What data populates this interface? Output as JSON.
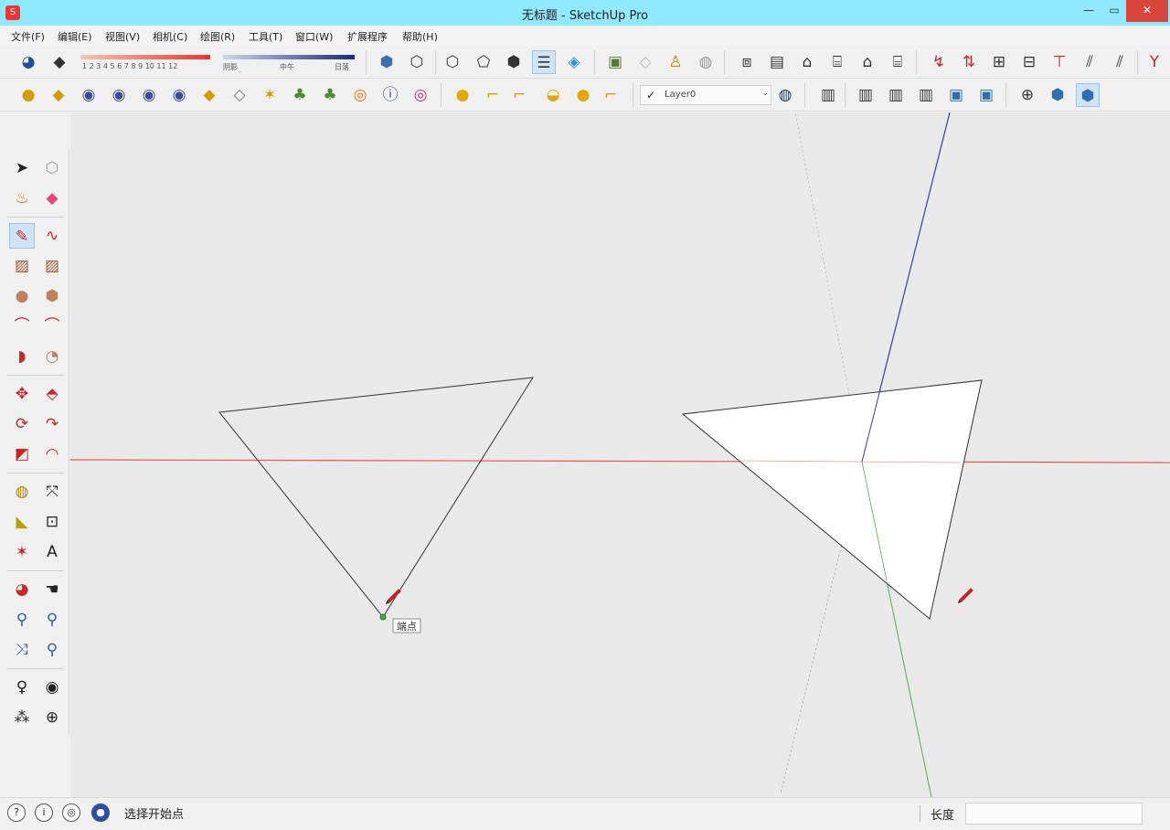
{
  "window": {
    "title": "无标题 - SketchUp Pro",
    "minimize": "—",
    "maximize": "▭",
    "close": "✕"
  },
  "menu": [
    {
      "label": "文件(F)"
    },
    {
      "label": "编辑(E)"
    },
    {
      "label": "视图(V)"
    },
    {
      "label": "相机(C)"
    },
    {
      "label": "绘图(R)"
    },
    {
      "label": "工具(T)"
    },
    {
      "label": "窗口(W)"
    },
    {
      "label": "扩展程序"
    },
    {
      "label": "帮助(H)"
    }
  ],
  "toolbar": {
    "slider1_scale": "1 2 3 4 5 6 7 8 9 10 11 12",
    "slider2_left": "阴影",
    "slider2_mid": "中午",
    "slider2_right": "日落",
    "layer_check": "✓",
    "layer_name": "Layer0",
    "layer_arrow": "⌄"
  },
  "viewport": {
    "cursor_tooltip": "端点",
    "colors": {
      "red_axis": "#e05a4a",
      "blue_axis": "#3b3f96",
      "green_axis": "#5aa85a",
      "edge": "#333333",
      "face": "#ffffff",
      "pencil": "#c0262a"
    }
  },
  "statusbar": {
    "info_icon": "i",
    "user_icon": "◎",
    "globe_icon": "●",
    "help_icon": "?",
    "prompt": "选择开始点",
    "length_label": "长度",
    "length_value": ""
  }
}
